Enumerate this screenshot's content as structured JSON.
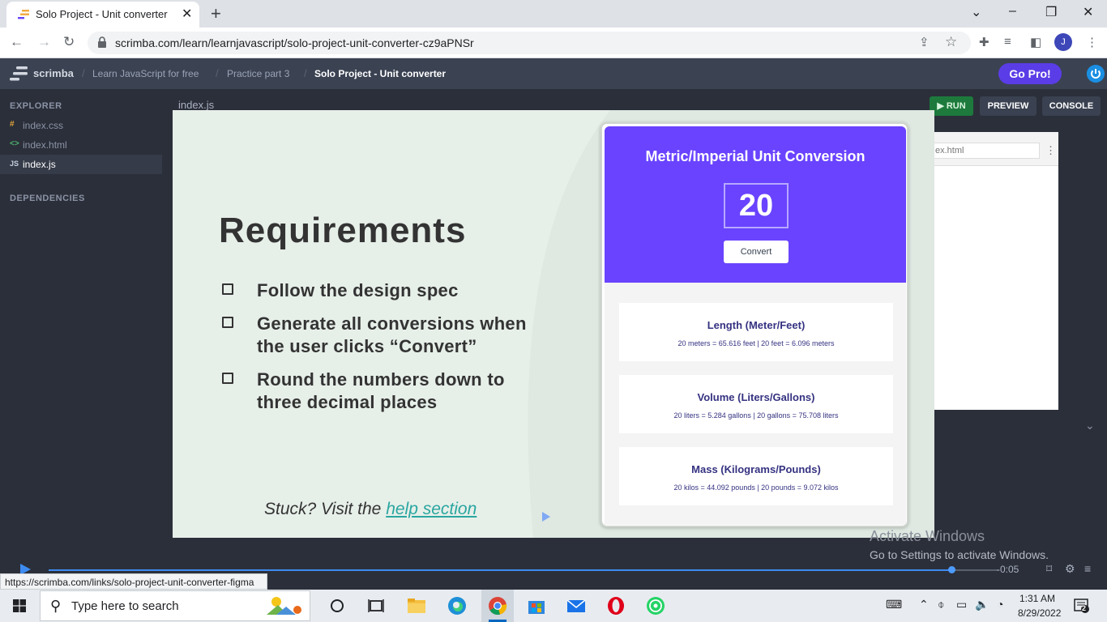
{
  "browser": {
    "tab_title": "Solo Project - Unit converter",
    "tab_close": "✕",
    "new_tab": "+",
    "url": "scrimba.com/learn/learnjavascript/solo-project-unit-converter-cz9aPNSr",
    "status_url": "https://scrimba.com/links/solo-project-unit-converter-figma",
    "profile_initial": "J"
  },
  "header": {
    "logo_text": "scrimba",
    "breadcrumbs": [
      "Learn JavaScript for free",
      "Practice part 3",
      "Solo Project - Unit converter"
    ],
    "go_pro": "Go Pro!"
  },
  "sidebar": {
    "explorer_label": "EXPLORER",
    "files": [
      {
        "icon": "#",
        "name": "index.css",
        "color": "#e2a53b"
      },
      {
        "icon": "<>",
        "name": "index.html",
        "color": "#4fb36d"
      },
      {
        "icon": "JS",
        "name": "index.js",
        "color": "#c7d0e0"
      }
    ],
    "dependencies_label": "DEPENDENCIES"
  },
  "editor": {
    "tab": "index.js",
    "run": "RUN",
    "preview": "PREVIEW",
    "console": "CONSOLE",
    "preview_url": "ex.html"
  },
  "slide": {
    "title": "Requirements",
    "items": [
      [
        "Follow the design spec"
      ],
      [
        "Generate all conversions when",
        "the user clicks “Convert”"
      ],
      [
        "Round the numbers down to",
        "three decimal places"
      ]
    ],
    "stuck_text": "Stuck? Visit the",
    "help_link": "help section",
    "card": {
      "title": "Metric/Imperial Unit Conversion",
      "value": "20",
      "button": "Convert",
      "results": [
        {
          "title": "Length (Meter/Feet)",
          "text": "20 meters = 65.616 feet | 20 feet = 6.096 meters"
        },
        {
          "title": "Volume (Liters/Gallons)",
          "text": "20 liters = 5.284 gallons | 20 gallons = 75.708 liters"
        },
        {
          "title": "Mass (Kilograms/Pounds)",
          "text": "20 kilos = 44.092 pounds | 20 pounds = 9.072 kilos"
        }
      ]
    }
  },
  "video": {
    "progress": 0.95,
    "time": "-0:05"
  },
  "watermark": {
    "line1": "Activate Windows",
    "line2": "Go to Settings to activate Windows."
  },
  "taskbar": {
    "search_placeholder": "Type here to search",
    "time": "1:31 AM",
    "date": "8/29/2022",
    "notifications": "2"
  },
  "colors": {
    "scrimba_purple": "#6943ff",
    "go_pro": "#5a3de6",
    "run_green": "#1d7a3c",
    "link_teal": "#2aa6a0"
  }
}
